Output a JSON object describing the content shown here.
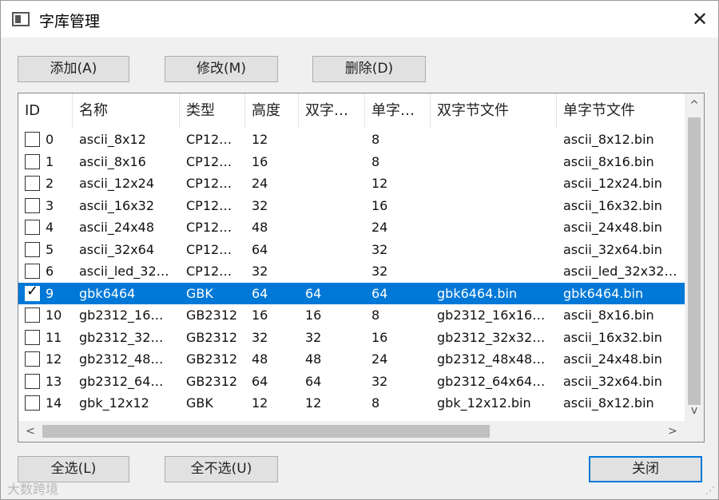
{
  "window": {
    "title": "字库管理",
    "close_glyph": "✕"
  },
  "toolbar": {
    "add": "添加(A)",
    "edit": "修改(M)",
    "delete": "删除(D)"
  },
  "columns": [
    "ID",
    "名称",
    "类型",
    "高度",
    "双字…",
    "单字…",
    "双字节文件",
    "单字节文件"
  ],
  "rows": [
    {
      "checked": false,
      "selected": false,
      "id": "0",
      "name": "ascii_8x12",
      "type": "CP12…",
      "height": "12",
      "dbcs": "",
      "sbcs": "8",
      "dbcs_file": "",
      "sbcs_file": "ascii_8x12.bin"
    },
    {
      "checked": false,
      "selected": false,
      "id": "1",
      "name": "ascii_8x16",
      "type": "CP12…",
      "height": "16",
      "dbcs": "",
      "sbcs": "8",
      "dbcs_file": "",
      "sbcs_file": "ascii_8x16.bin"
    },
    {
      "checked": false,
      "selected": false,
      "id": "2",
      "name": "ascii_12x24",
      "type": "CP12…",
      "height": "24",
      "dbcs": "",
      "sbcs": "12",
      "dbcs_file": "",
      "sbcs_file": "ascii_12x24.bin"
    },
    {
      "checked": false,
      "selected": false,
      "id": "3",
      "name": "ascii_16x32",
      "type": "CP12…",
      "height": "32",
      "dbcs": "",
      "sbcs": "16",
      "dbcs_file": "",
      "sbcs_file": "ascii_16x32.bin"
    },
    {
      "checked": false,
      "selected": false,
      "id": "4",
      "name": "ascii_24x48",
      "type": "CP12…",
      "height": "48",
      "dbcs": "",
      "sbcs": "24",
      "dbcs_file": "",
      "sbcs_file": "ascii_24x48.bin"
    },
    {
      "checked": false,
      "selected": false,
      "id": "5",
      "name": "ascii_32x64",
      "type": "CP12…",
      "height": "64",
      "dbcs": "",
      "sbcs": "32",
      "dbcs_file": "",
      "sbcs_file": "ascii_32x64.bin"
    },
    {
      "checked": false,
      "selected": false,
      "id": "6",
      "name": "ascii_led_32…",
      "type": "CP12…",
      "height": "32",
      "dbcs": "",
      "sbcs": "32",
      "dbcs_file": "",
      "sbcs_file": "ascii_led_32x32…"
    },
    {
      "checked": true,
      "selected": true,
      "id": "9",
      "name": "gbk6464",
      "type": "GBK",
      "height": "64",
      "dbcs": "64",
      "sbcs": "64",
      "dbcs_file": "gbk6464.bin",
      "sbcs_file": "gbk6464.bin"
    },
    {
      "checked": false,
      "selected": false,
      "id": "10",
      "name": "gb2312_16…",
      "type": "GB2312",
      "height": "16",
      "dbcs": "16",
      "sbcs": "8",
      "dbcs_file": "gb2312_16x16…",
      "sbcs_file": "ascii_8x16.bin"
    },
    {
      "checked": false,
      "selected": false,
      "id": "11",
      "name": "gb2312_32…",
      "type": "GB2312",
      "height": "32",
      "dbcs": "32",
      "sbcs": "16",
      "dbcs_file": "gb2312_32x32…",
      "sbcs_file": "ascii_16x32.bin"
    },
    {
      "checked": false,
      "selected": false,
      "id": "12",
      "name": "gb2312_48…",
      "type": "GB2312",
      "height": "48",
      "dbcs": "48",
      "sbcs": "24",
      "dbcs_file": "gb2312_48x48…",
      "sbcs_file": "ascii_24x48.bin"
    },
    {
      "checked": false,
      "selected": false,
      "id": "13",
      "name": "gb2312_64…",
      "type": "GB2312",
      "height": "64",
      "dbcs": "64",
      "sbcs": "32",
      "dbcs_file": "gb2312_64x64…",
      "sbcs_file": "ascii_32x64.bin"
    },
    {
      "checked": false,
      "selected": false,
      "id": "14",
      "name": "gbk_12x12",
      "type": "GBK",
      "height": "12",
      "dbcs": "12",
      "sbcs": "8",
      "dbcs_file": "gbk_12x12.bin",
      "sbcs_file": "ascii_8x12.bin"
    }
  ],
  "scroll": {
    "up": "^",
    "down": "v",
    "left": "<",
    "right": ">"
  },
  "footer": {
    "select_all": "全选(L)",
    "select_none": "全不选(U)",
    "close": "关闭"
  },
  "watermark": "大数跨境",
  "colors": {
    "selection": "#0078d7",
    "default_button_border": "#0078d7"
  }
}
